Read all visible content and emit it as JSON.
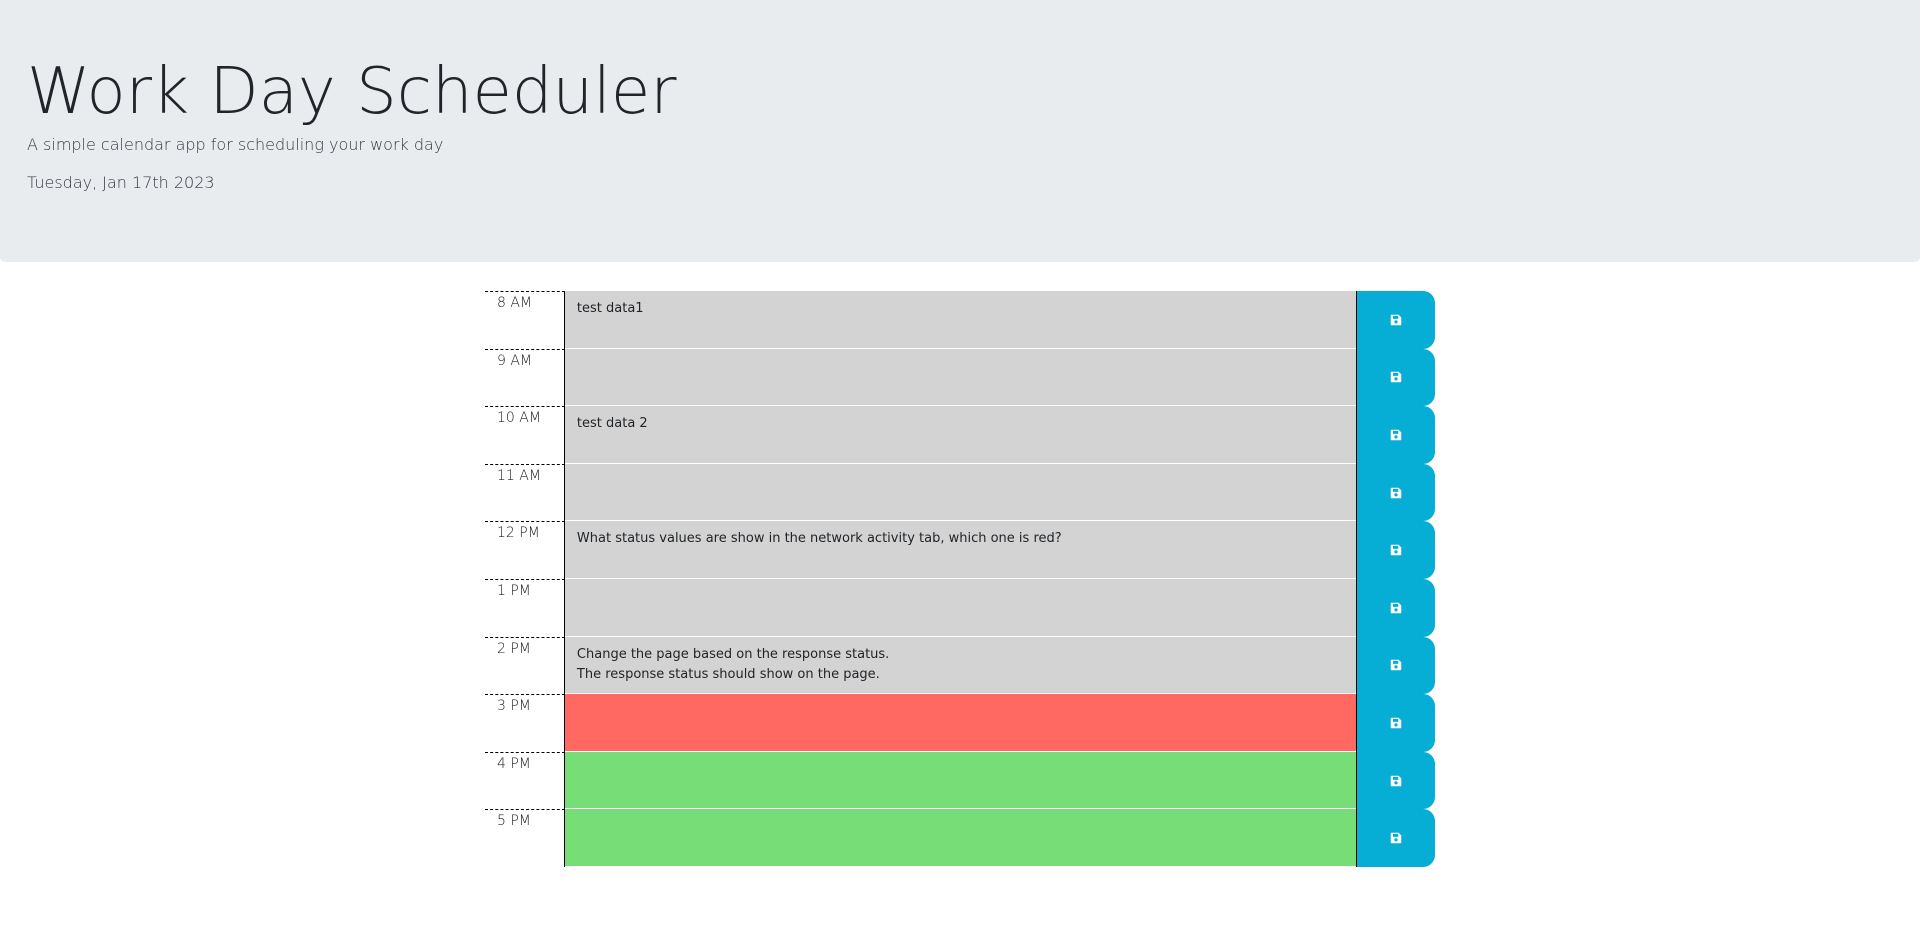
{
  "header": {
    "title": "Work Day Scheduler",
    "subtitle": "A simple calendar app for scheduling your work day",
    "current_day": "Tuesday, Jan 17th 2023"
  },
  "colors": {
    "past": "#d3d3d3",
    "present": "#ff6961",
    "future": "#77dd77",
    "save_button": "#06aed5",
    "header_bg": "#e9ecef"
  },
  "save_icon": "floppy-disk-icon",
  "schedule": [
    {
      "hour": "8 AM",
      "text": "test data1",
      "state": "past"
    },
    {
      "hour": "9 AM",
      "text": "",
      "state": "past"
    },
    {
      "hour": "10 AM",
      "text": "test data 2",
      "state": "past"
    },
    {
      "hour": "11 AM",
      "text": "",
      "state": "past"
    },
    {
      "hour": "12 PM",
      "text": "What status values are show in the network activity tab, which one is red?",
      "state": "past"
    },
    {
      "hour": "1 PM",
      "text": "",
      "state": "past"
    },
    {
      "hour": "2 PM",
      "text": "Change the page based on the response status.\nThe response status should show on the page.",
      "state": "past"
    },
    {
      "hour": "3 PM",
      "text": "",
      "state": "present"
    },
    {
      "hour": "4 PM",
      "text": "",
      "state": "future"
    },
    {
      "hour": "5 PM",
      "text": "",
      "state": "future"
    }
  ]
}
